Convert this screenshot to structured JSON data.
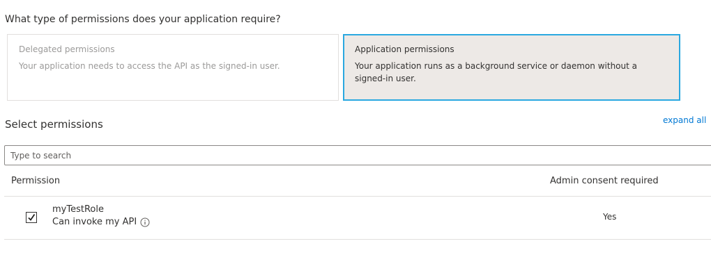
{
  "question": "What type of permissions does your application require?",
  "cards": {
    "delegated": {
      "title": "Delegated permissions",
      "description": "Your application needs to access the API as the signed-in user."
    },
    "application": {
      "title": "Application permissions",
      "description": "Your application runs as a background service or daemon without a signed-in user."
    }
  },
  "select_permissions": {
    "title": "Select permissions",
    "expand_all": "expand all"
  },
  "search": {
    "placeholder": "Type to search"
  },
  "table": {
    "headers": {
      "permission": "Permission",
      "admin_consent": "Admin consent required"
    },
    "rows": [
      {
        "name": "myTestRole",
        "description": "Can invoke my API",
        "admin_consent": "Yes",
        "checked": true
      }
    ]
  },
  "colors": {
    "accent_border": "#2aa8e0",
    "link": "#0078d4",
    "selected_card_bg": "#ede9e6"
  },
  "icons": {
    "checkbox": "checkmark-icon",
    "info": "info-icon"
  }
}
